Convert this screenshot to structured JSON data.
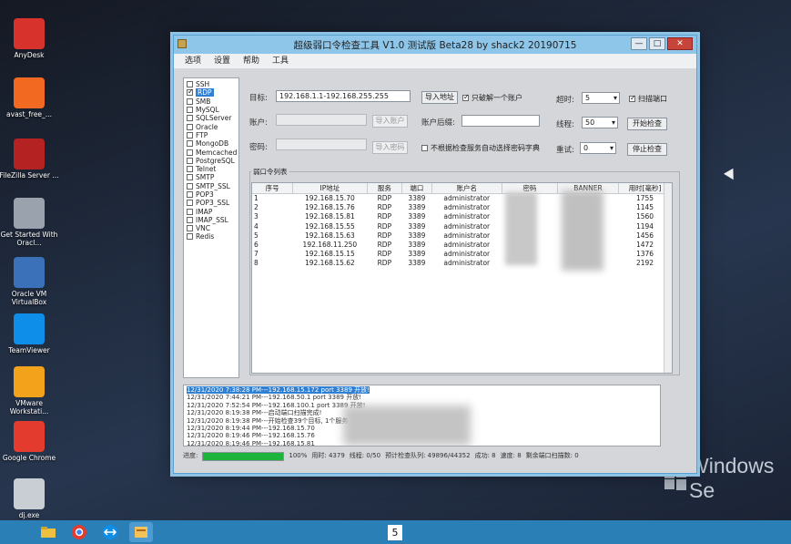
{
  "desktop": {
    "icons": [
      {
        "label": "AnyDesk",
        "color": "#d8322c"
      },
      {
        "label": "avast_free_...",
        "color": "#f26a21"
      },
      {
        "label": "FileZilla Server ...",
        "color": "#b42222"
      },
      {
        "label": "Get Started With Oracl...",
        "color": "#9aa3ad"
      },
      {
        "label": "Oracle VM VirtualBox",
        "color": "#3a71b8"
      },
      {
        "label": "TeamViewer",
        "color": "#0e8ee9"
      },
      {
        "label": "VMware Workstati...",
        "color": "#f3a21b"
      },
      {
        "label": "Google Chrome",
        "color": "#e33b2e"
      },
      {
        "label": "dj.exe",
        "color": "#c9ced4"
      }
    ],
    "brand": "Windows Se",
    "page_number": "5"
  },
  "window": {
    "title": "超级弱口令检查工具 V1.0 测试版 Beta28 by shack2 20190715",
    "controls": {
      "minimize": "—",
      "maximize": "□",
      "close": "✕"
    },
    "menu": [
      "选项",
      "设置",
      "帮助",
      "工具"
    ]
  },
  "services": [
    {
      "name": "SSH",
      "checked": false
    },
    {
      "name": "RDP",
      "checked": true,
      "selected": true
    },
    {
      "name": "SMB",
      "checked": false
    },
    {
      "name": "MySQL",
      "checked": false
    },
    {
      "name": "SQLServer",
      "checked": false
    },
    {
      "name": "Oracle",
      "checked": false
    },
    {
      "name": "FTP",
      "checked": false
    },
    {
      "name": "MongoDB",
      "checked": false
    },
    {
      "name": "Memcached",
      "checked": false
    },
    {
      "name": "PostgreSQL",
      "checked": false
    },
    {
      "name": "Telnet",
      "checked": false
    },
    {
      "name": "SMTP",
      "checked": false
    },
    {
      "name": "SMTP_SSL",
      "checked": false
    },
    {
      "name": "POP3",
      "checked": false
    },
    {
      "name": "POP3_SSL",
      "checked": false
    },
    {
      "name": "IMAP",
      "checked": false
    },
    {
      "name": "IMAP_SSL",
      "checked": false
    },
    {
      "name": "VNC",
      "checked": false
    },
    {
      "name": "Redis",
      "checked": false
    }
  ],
  "form": {
    "target_label": "目标:",
    "target_value": "192.168.1.1-192.168.255.255",
    "import_address": "导入地址",
    "only_one_account": "只破解一个账户",
    "timeout_label": "超时:",
    "timeout_value": "5",
    "scan_port": "扫描端口",
    "account_label": "账户:",
    "import_account": "导入账户",
    "account_suffix_label": "账户后缀:",
    "threads_label": "线程:",
    "threads_value": "50",
    "start_check": "开始检查",
    "password_label": "密码:",
    "import_password": "导入密码",
    "auto_dict": "不根据检查服务自动选择密码字典",
    "retry_label": "重试:",
    "retry_value": "0",
    "stop_check": "停止检查"
  },
  "results": {
    "legend": "弱口令列表",
    "columns": [
      "序号",
      "IP地址",
      "服务",
      "端口",
      "账户名",
      "密码",
      "BANNER",
      "用时[毫秒]"
    ],
    "rows": [
      [
        "1",
        "192.168.15.70",
        "RDP",
        "3389",
        "administrator",
        "",
        "",
        "1755"
      ],
      [
        "2",
        "192.168.15.76",
        "RDP",
        "3389",
        "administrator",
        "",
        "",
        "1145"
      ],
      [
        "3",
        "192.168.15.81",
        "RDP",
        "3389",
        "administrator",
        "",
        "",
        "1560"
      ],
      [
        "4",
        "192.168.15.55",
        "RDP",
        "3389",
        "administrator",
        "",
        "",
        "1194"
      ],
      [
        "5",
        "192.168.15.63",
        "RDP",
        "3389",
        "administrator",
        "",
        "",
        "1456"
      ],
      [
        "6",
        "192.168.11.250",
        "RDP",
        "3389",
        "administrator",
        "",
        "",
        "1472"
      ],
      [
        "7",
        "192.168.15.15",
        "RDP",
        "3389",
        "administrator",
        "",
        "",
        "1376"
      ],
      [
        "8",
        "192.168.15.62",
        "RDP",
        "3389",
        "administrator",
        "",
        "",
        "2192"
      ]
    ]
  },
  "log": [
    "12/31/2020 7:38:28 PM---192.168.15.172 port 3389 开放!",
    "12/31/2020 7:44:21 PM---192.168.50.1 port 3389 开放!",
    "12/31/2020 7:52:54 PM---192.168.100.1 port 3389 开放!",
    "12/31/2020 8:19:38 PM---启动端口扫描完成!",
    "12/31/2020 8:19:38 PM---开始检查39个目标, 1个服务",
    "12/31/2020 8:19:44 PM---192.168.15.70",
    "12/31/2020 8:19:46 PM---192.168.15.76",
    "12/31/2020 8:19:46 PM---192.168.15.81"
  ],
  "status": {
    "progress_label": "进度:",
    "progress_percent": 100,
    "progress_text": "100%",
    "elapsed": "用时: 4379",
    "threads": "线程: 0/50",
    "queue": "预计检查队列: 49896/44352",
    "success": "成功: 8",
    "speed": "速度: 8",
    "remaining": "剩余端口扫描数: 0"
  }
}
